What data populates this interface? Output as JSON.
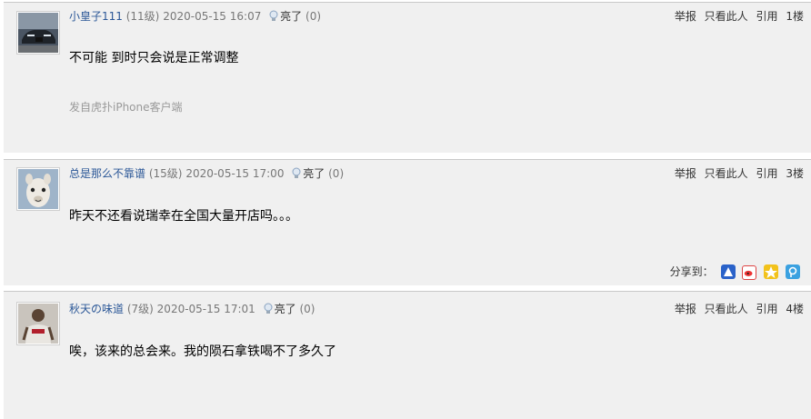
{
  "posts": [
    {
      "username": "小皇子111",
      "level": "(11级)",
      "datetime": "2020-05-15 16:07",
      "light_label": "亮了",
      "light_count": "(0)",
      "actions": {
        "report": "举报",
        "only_this": "只看此人",
        "quote": "引用",
        "floor": "1楼"
      },
      "content": "不可能 到时只会说是正常调整",
      "source": "发自虎扑iPhone客户端",
      "avatar_icon": "car-avatar"
    },
    {
      "username": "总是那么不靠谱",
      "level": "(15级)",
      "datetime": "2020-05-15 17:00",
      "light_label": "亮了",
      "light_count": "(0)",
      "actions": {
        "report": "举报",
        "only_this": "只看此人",
        "quote": "引用",
        "floor": "3楼"
      },
      "content": "昨天不还看说瑞幸在全国大量开店吗。。。",
      "share_label": "分享到：",
      "avatar_icon": "alpaca-avatar"
    },
    {
      "username": "秋天の味道",
      "level": "(7级)",
      "datetime": "2020-05-15 17:01",
      "light_label": "亮了",
      "light_count": "(0)",
      "actions": {
        "report": "举报",
        "only_this": "只看此人",
        "quote": "引用",
        "floor": "4楼"
      },
      "content": "唉，该来的总会来。我的陨石拿铁喝不了多久了",
      "avatar_icon": "basketball-player-avatar"
    }
  ],
  "share_icons": [
    "baidu-share-icon",
    "weibo-share-icon",
    "qzone-share-icon",
    "tencent-share-icon"
  ],
  "colors": {
    "username": "#2b5797",
    "post_bg": "#f0f0f0",
    "meta_gray": "#777777"
  }
}
